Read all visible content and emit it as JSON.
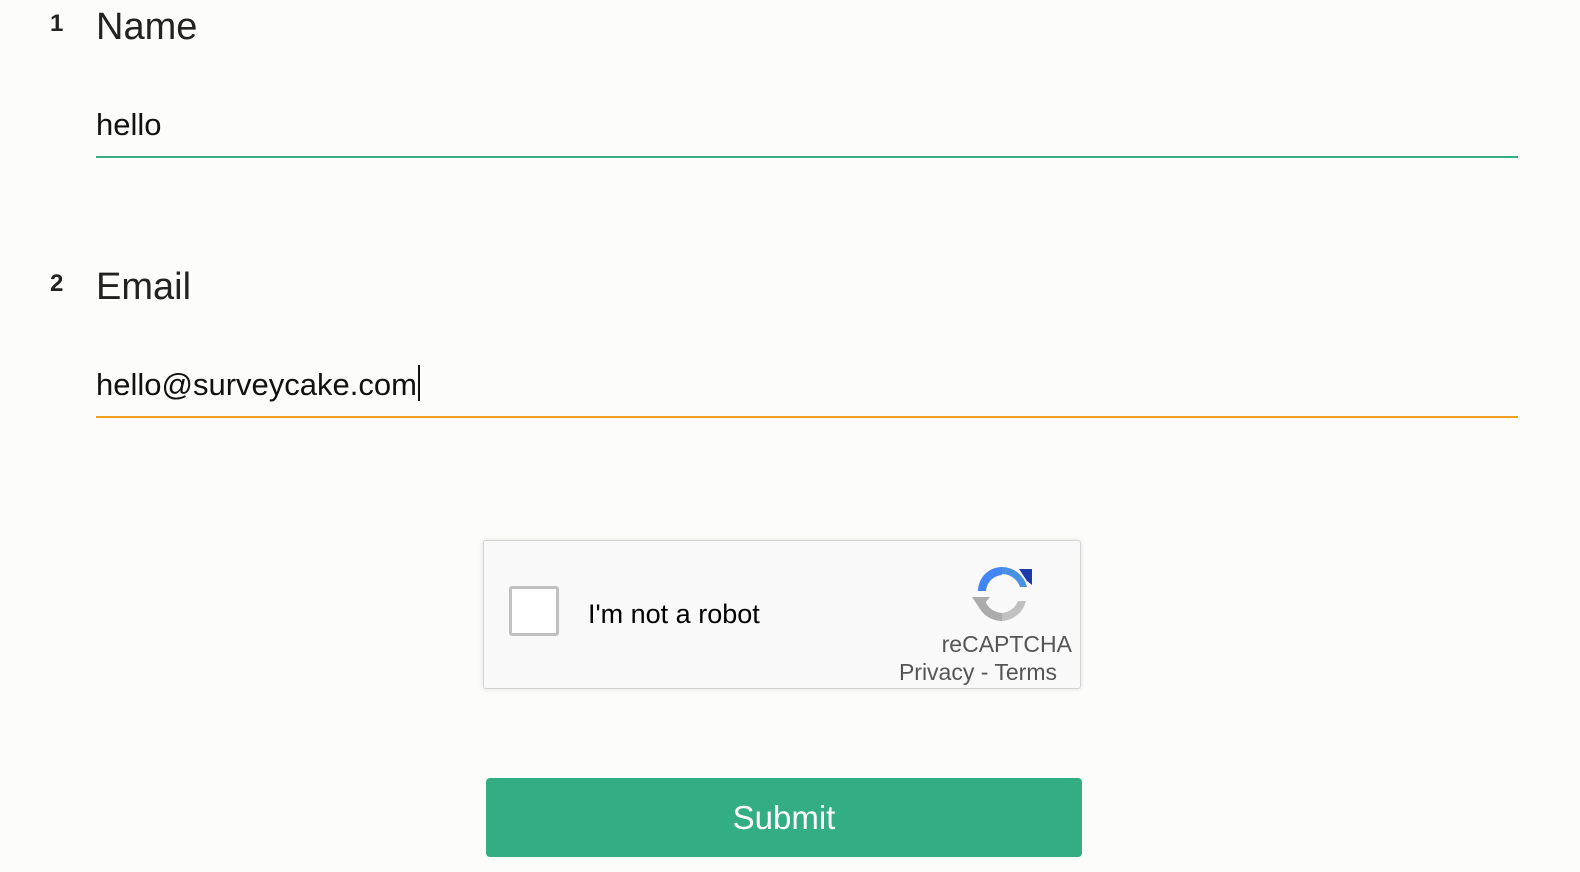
{
  "questions": [
    {
      "number": "1",
      "title": "Name",
      "value": "hello"
    },
    {
      "number": "2",
      "title": "Email",
      "value": "hello@surveycake.com"
    }
  ],
  "recaptcha": {
    "label": "I'm not a robot",
    "brand": "reCAPTCHA",
    "privacy": "Privacy",
    "separator": " - ",
    "terms": "Terms",
    "logo_icon": "recaptcha-logo-icon"
  },
  "submit": {
    "label": "Submit"
  },
  "colors": {
    "accent": "#33ad84",
    "focus_underline": "#f0a020",
    "default_underline": "#3aab87"
  }
}
